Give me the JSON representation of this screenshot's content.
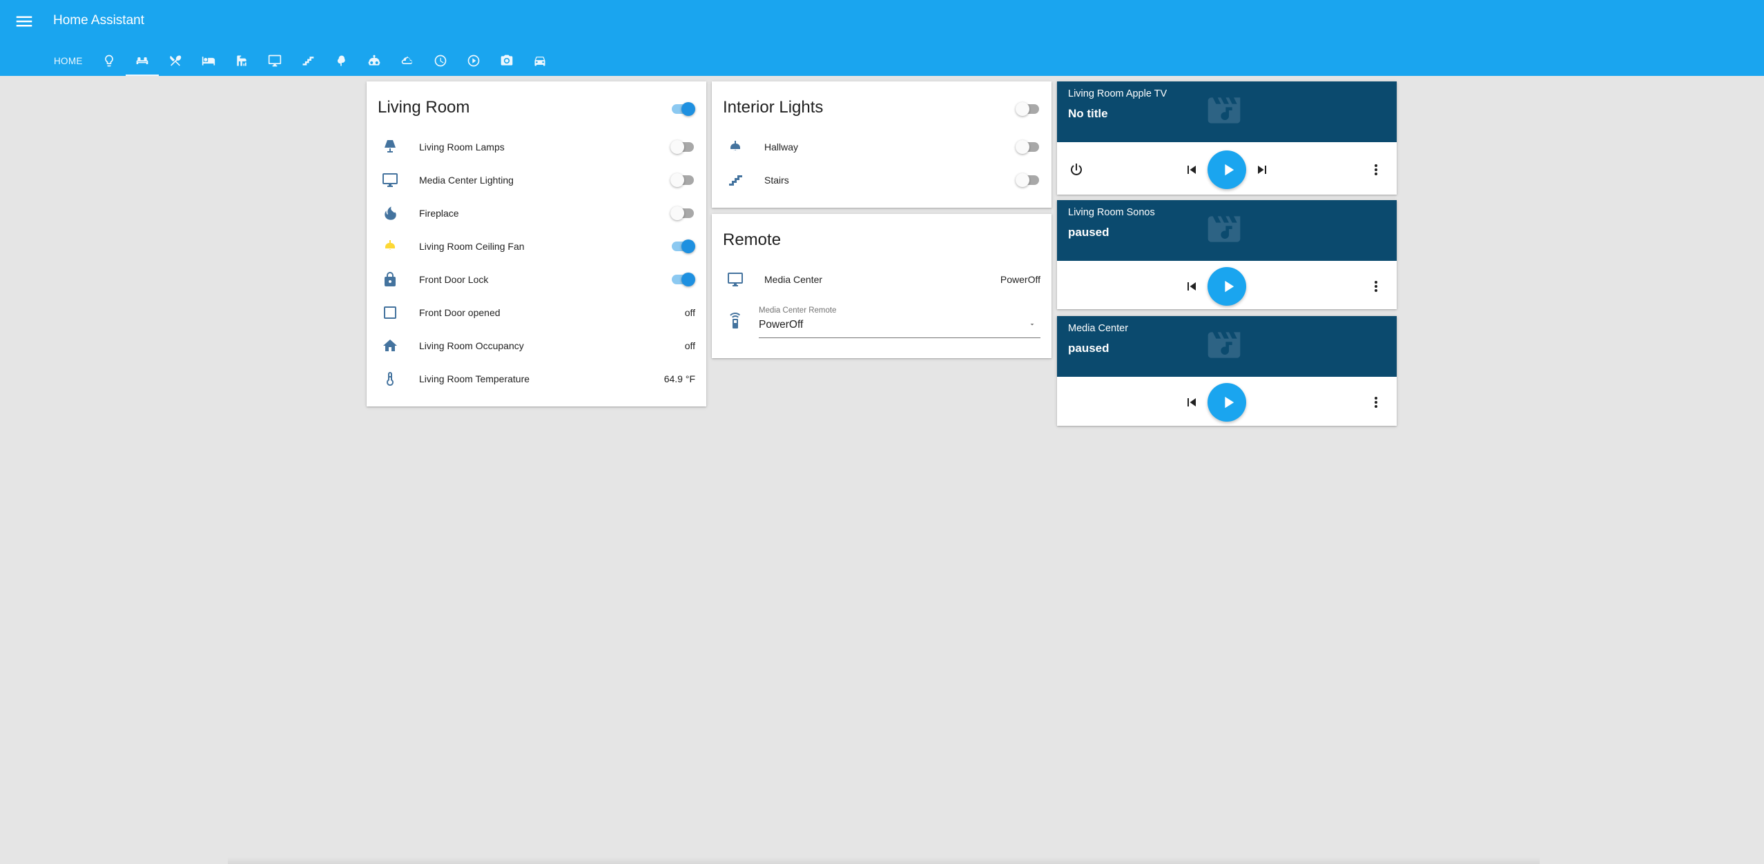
{
  "app": {
    "title": "Home Assistant"
  },
  "tabs": [
    {
      "label": "HOME",
      "icon": "home-text"
    },
    {
      "icon": "lightbulb-icon"
    },
    {
      "icon": "sofa-icon",
      "active": true
    },
    {
      "icon": "silverware-icon"
    },
    {
      "icon": "bed-icon"
    },
    {
      "icon": "bathroom-icon"
    },
    {
      "icon": "monitor-icon"
    },
    {
      "icon": "stairs-icon"
    },
    {
      "icon": "tree-icon"
    },
    {
      "icon": "robot-icon"
    },
    {
      "icon": "weather-icon"
    },
    {
      "icon": "clock-icon"
    },
    {
      "icon": "play-circle-icon"
    },
    {
      "icon": "camera-icon"
    },
    {
      "icon": "car-icon"
    }
  ],
  "living_room": {
    "title": "Living Room",
    "toggle_on": true,
    "rows": [
      {
        "label": "Living Room Lamps",
        "icon": "lamp-icon",
        "type": "toggle",
        "on": false
      },
      {
        "label": "Media Center Lighting",
        "icon": "monitor-icon",
        "type": "toggle",
        "on": false
      },
      {
        "label": "Fireplace",
        "icon": "fire-icon",
        "type": "toggle",
        "on": false
      },
      {
        "label": "Living Room Ceiling Fan",
        "icon": "ceiling-light-icon",
        "type": "toggle",
        "on": true
      },
      {
        "label": "Front Door Lock",
        "icon": "lock-icon",
        "type": "toggle",
        "on": true
      },
      {
        "label": "Front Door opened",
        "icon": "checkbox-blank-icon",
        "type": "state",
        "state": "off"
      },
      {
        "label": "Living Room Occupancy",
        "icon": "home-icon",
        "type": "state",
        "state": "off"
      },
      {
        "label": "Living Room Temperature",
        "icon": "thermometer-icon",
        "type": "state",
        "state": "64.9 °F"
      }
    ]
  },
  "interior_lights": {
    "title": "Interior Lights",
    "toggle_on": false,
    "rows": [
      {
        "label": "Hallway",
        "icon": "ceiling-light-icon",
        "on": false
      },
      {
        "label": "Stairs",
        "icon": "stairs-icon",
        "on": false
      }
    ]
  },
  "remote": {
    "title": "Remote",
    "row": {
      "label": "Media Center",
      "icon": "monitor-icon",
      "state": "PowerOff"
    },
    "select": {
      "icon": "remote-icon",
      "label": "Media Center Remote",
      "value": "PowerOff"
    }
  },
  "media_players": [
    {
      "name": "Living Room Apple TV",
      "state": "No title",
      "controls": [
        "power",
        "previous",
        "play",
        "next",
        "more"
      ]
    },
    {
      "name": "Living Room Sonos",
      "state": "paused",
      "controls": [
        "previous",
        "play",
        "more"
      ]
    },
    {
      "name": "Media Center",
      "state": "paused",
      "controls": [
        "previous",
        "play",
        "more"
      ]
    }
  ],
  "colors": {
    "header": "#1aa5ef",
    "icon": "#44739e",
    "active_icon": "#fdd835",
    "media_banner": "#0b4a6e",
    "toggle_on": "#1e90e0"
  }
}
